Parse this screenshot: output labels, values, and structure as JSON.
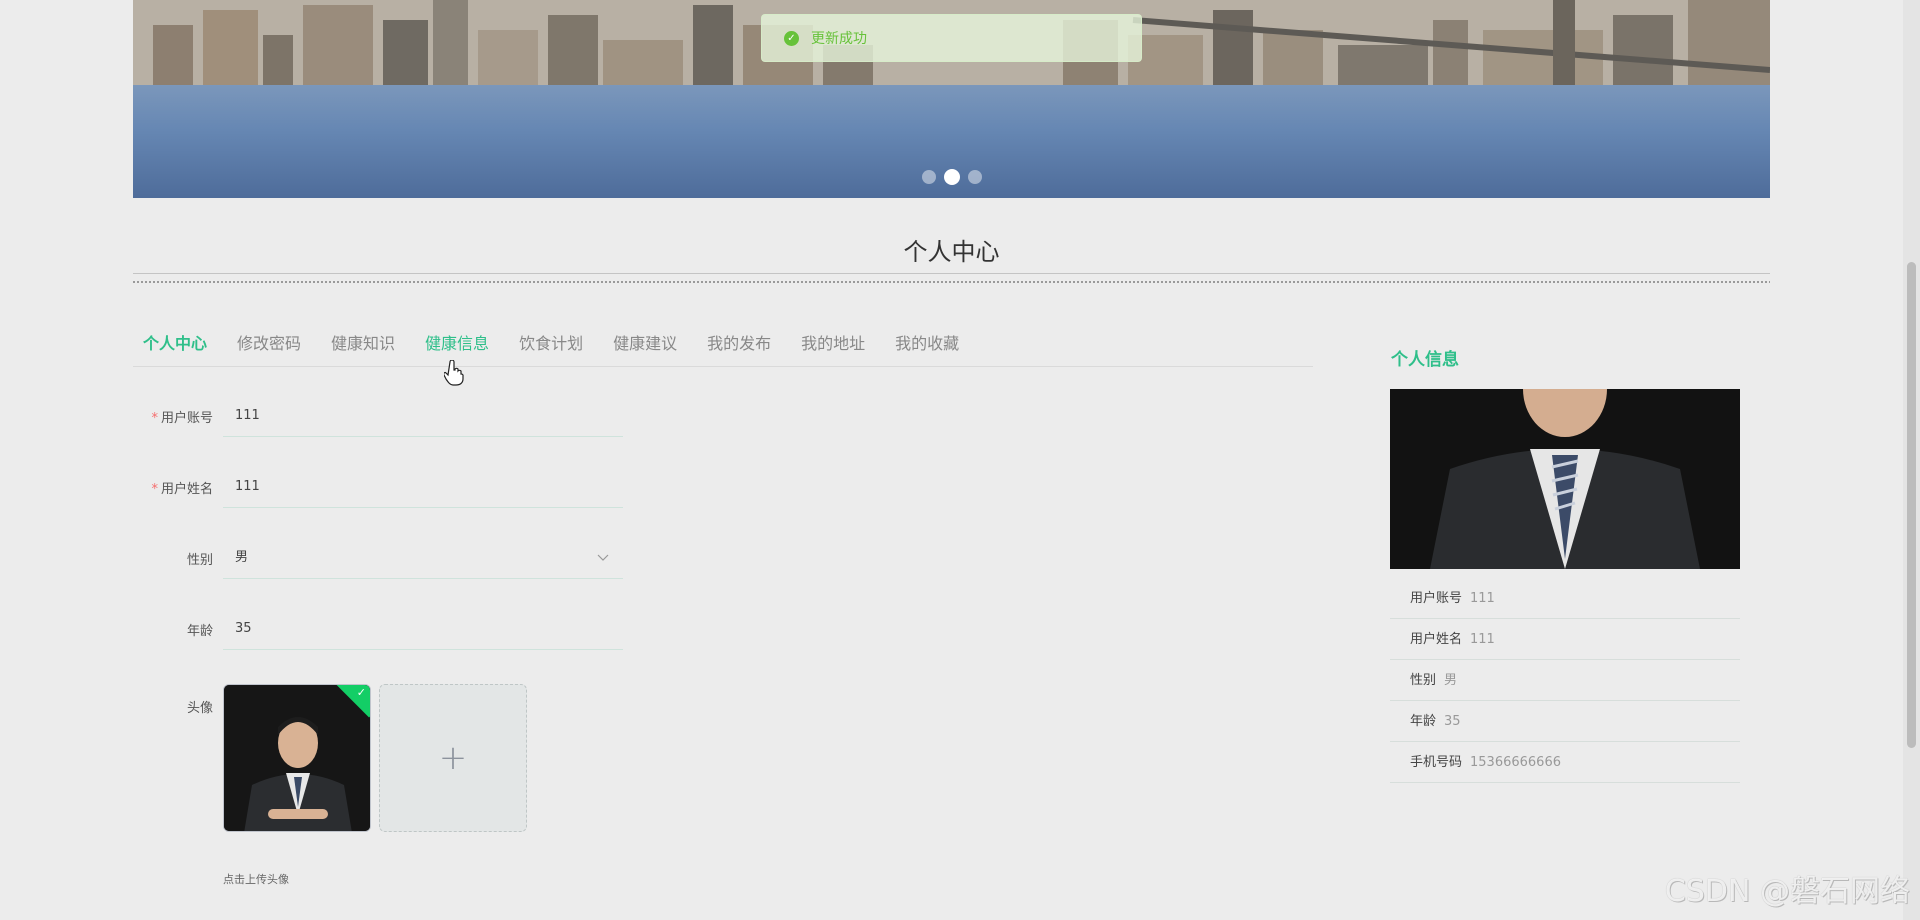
{
  "toast": {
    "icon": "check-circle-icon",
    "message": "更新成功"
  },
  "carousel": {
    "slides": 3,
    "active_index": 1
  },
  "page": {
    "title": "个人中心"
  },
  "tabs": [
    {
      "label": "个人中心",
      "active": true
    },
    {
      "label": "修改密码"
    },
    {
      "label": "健康知识"
    },
    {
      "label": "健康信息",
      "hover": true
    },
    {
      "label": "饮食计划"
    },
    {
      "label": "健康建议"
    },
    {
      "label": "我的发布"
    },
    {
      "label": "我的地址"
    },
    {
      "label": "我的收藏"
    }
  ],
  "form": {
    "account": {
      "label": "用户账号",
      "required": true,
      "value": "111"
    },
    "name": {
      "label": "用户姓名",
      "required": true,
      "value": "111"
    },
    "gender": {
      "label": "性别",
      "value": "男",
      "icon": "chevron-down-icon"
    },
    "age": {
      "label": "年龄",
      "value": "35"
    },
    "avatar": {
      "label": "头像",
      "upload_icon": "plus-icon",
      "tip": "点击上传头像"
    }
  },
  "side": {
    "title": "个人信息",
    "rows": [
      {
        "label": "用户账号",
        "value": "111"
      },
      {
        "label": "用户姓名",
        "value": "111"
      },
      {
        "label": "性别",
        "value": "男"
      },
      {
        "label": "年龄",
        "value": "35"
      },
      {
        "label": "手机号码",
        "value": "15366666666"
      }
    ]
  },
  "watermark": "CSDN @磐石网络",
  "colors": {
    "accent": "#2fbf8a",
    "success": "#67c23a",
    "required": "#f56c6c"
  }
}
